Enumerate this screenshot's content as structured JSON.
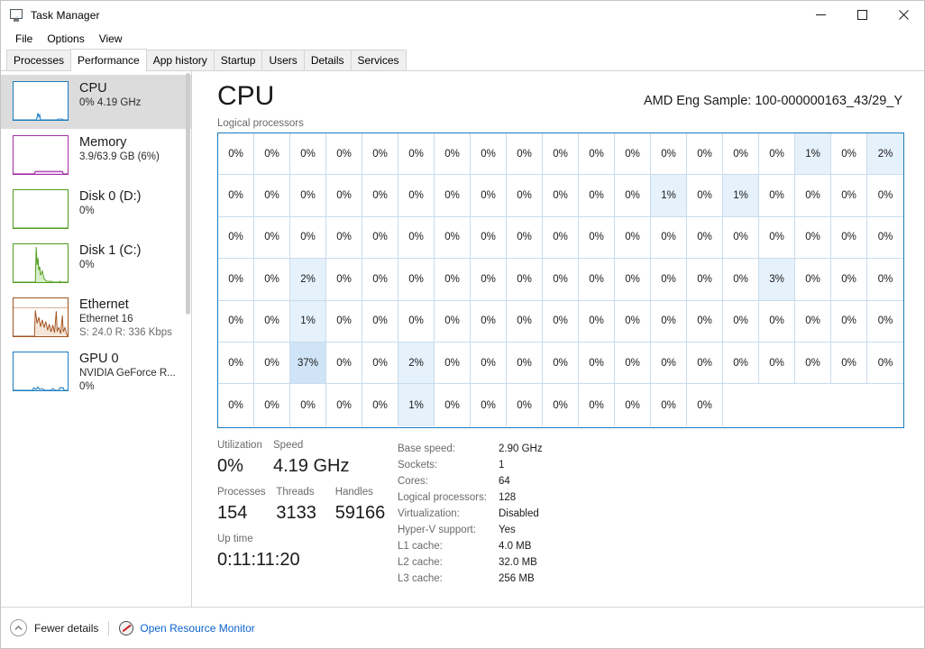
{
  "window": {
    "title": "Task Manager",
    "icon": "task-manager-icon",
    "controls": {
      "minimize": "minimize",
      "maximize": "maximize",
      "close": "close"
    }
  },
  "menu": {
    "items": [
      "File",
      "Options",
      "View"
    ]
  },
  "tabs": {
    "items": [
      "Processes",
      "Performance",
      "App history",
      "Startup",
      "Users",
      "Details",
      "Services"
    ],
    "active": "Performance"
  },
  "sidebar": {
    "items": [
      {
        "name": "CPU",
        "sub1": "0%  4.19 GHz",
        "sub2": "",
        "sub3": "",
        "color": "#1a7bbf",
        "selected": true
      },
      {
        "name": "Memory",
        "sub1": "3.9/63.9 GB (6%)",
        "sub2": "",
        "sub3": "",
        "color": "#a32ba8",
        "selected": false
      },
      {
        "name": "Disk 0 (D:)",
        "sub1": "0%",
        "sub2": "",
        "sub3": "",
        "color": "#4f9c1f",
        "selected": false
      },
      {
        "name": "Disk 1 (C:)",
        "sub1": "0%",
        "sub2": "",
        "sub3": "",
        "color": "#4f9c1f",
        "selected": false
      },
      {
        "name": "Ethernet",
        "sub1": "Ethernet 16",
        "sub2": "S: 24.0  R: 336 Kbps",
        "sub3": "",
        "color": "#a1521d",
        "selected": false
      },
      {
        "name": "GPU 0",
        "sub1": "NVIDIA GeForce R...",
        "sub2": "0%",
        "sub3": "",
        "color": "#1a7bbf",
        "selected": false
      }
    ]
  },
  "main": {
    "title": "CPU",
    "cpu_name": "AMD Eng Sample: 100-000000163_43/29_Y",
    "grid_label": "Logical processors"
  },
  "chart_data": {
    "type": "heatmap",
    "title": "Logical processors",
    "columns": 19,
    "rows": 7,
    "total_cells": 128,
    "unit": "%",
    "values": [
      0,
      0,
      0,
      0,
      0,
      0,
      0,
      0,
      0,
      0,
      0,
      0,
      0,
      0,
      0,
      0,
      1,
      0,
      2,
      0,
      0,
      0,
      0,
      0,
      0,
      0,
      0,
      0,
      0,
      0,
      0,
      1,
      0,
      1,
      0,
      0,
      0,
      0,
      0,
      0,
      0,
      0,
      0,
      0,
      0,
      0,
      0,
      0,
      0,
      0,
      0,
      0,
      0,
      0,
      0,
      0,
      0,
      0,
      0,
      2,
      0,
      0,
      0,
      0,
      0,
      0,
      0,
      0,
      0,
      0,
      0,
      0,
      3,
      0,
      0,
      0,
      0,
      0,
      1,
      0,
      0,
      0,
      0,
      0,
      0,
      0,
      0,
      0,
      0,
      0,
      0,
      0,
      0,
      0,
      0,
      0,
      0,
      37,
      0,
      0,
      2,
      0,
      0,
      0,
      0,
      0,
      0,
      0,
      0,
      0,
      0,
      0,
      0,
      0,
      0,
      0,
      0,
      0,
      0,
      1,
      0,
      0,
      0,
      0,
      0,
      0,
      0,
      0
    ],
    "colors": {
      "idle": "#ffffff",
      "low": "#e5f1fb",
      "high": "#cfe4f7",
      "border": "#1a7bbf",
      "gridline": "#c9dced"
    }
  },
  "stats": {
    "utilization": {
      "label": "Utilization",
      "value": "0%"
    },
    "speed": {
      "label": "Speed",
      "value": "4.19 GHz"
    },
    "processes": {
      "label": "Processes",
      "value": "154"
    },
    "threads": {
      "label": "Threads",
      "value": "3133"
    },
    "handles": {
      "label": "Handles",
      "value": "59166"
    },
    "uptime": {
      "label": "Up time",
      "value": "0:11:11:20"
    }
  },
  "details": [
    {
      "key": "Base speed:",
      "value": "2.90 GHz"
    },
    {
      "key": "Sockets:",
      "value": "1"
    },
    {
      "key": "Cores:",
      "value": "64"
    },
    {
      "key": "Logical processors:",
      "value": "128"
    },
    {
      "key": "Virtualization:",
      "value": "Disabled"
    },
    {
      "key": "Hyper-V support:",
      "value": "Yes"
    },
    {
      "key": "L1 cache:",
      "value": "4.0 MB"
    },
    {
      "key": "L2 cache:",
      "value": "32.0 MB"
    },
    {
      "key": "L3 cache:",
      "value": "256 MB"
    }
  ],
  "footer": {
    "fewer_details": "Fewer details",
    "resource_monitor": "Open Resource Monitor",
    "link_color": "#0b63ce"
  }
}
